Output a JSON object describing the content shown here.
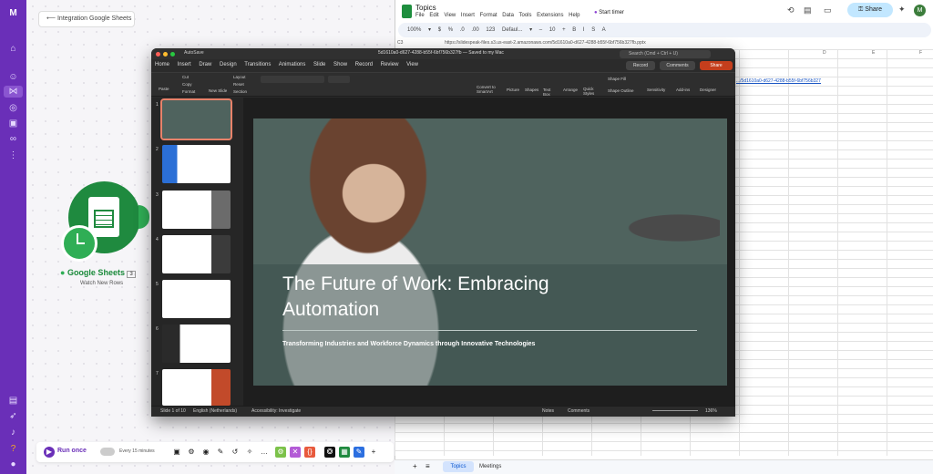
{
  "make": {
    "breadcrumb": "Integration Google Sheets",
    "module_name": "Google Sheets",
    "module_badge": "3",
    "module_sub": "Watch New Rows",
    "run_once": "Run once",
    "schedule": "Every 15 minutes"
  },
  "sheets": {
    "title": "Topics",
    "menu": "File Edit View Insert Format Data Tools Extensions Help",
    "timer": "Start timer",
    "share": "Share",
    "avatar": "M",
    "toolbar": "100% ▾   $   %   .0   .00   123   Defaul... ▾   –  10  +   B   I   S   A",
    "namebox": "C3",
    "formula": "https://slidespeak-files.s3.us-east-2.amazonaws.com/5d1610a0-d627-4288-b55f-6bf756b327fb.pptx",
    "cell_link": ".../5d1610a0-d627-4288-b55f-6bf756b327fb.pptx",
    "col_d": "D",
    "col_e": "E",
    "col_f": "F",
    "tab_topics": "Topics",
    "tab_meetings": "Meetings"
  },
  "ppt": {
    "autosave": "AutoSave",
    "file": "5d1610a0-d627-4288-b55f-6bf756b327fb — Saved to my Mac",
    "search": "Search (Cmd + Ctrl + U)",
    "tabs": "Home Insert Draw Design Transitions Animations Slide Show Record Review View",
    "record": "Record",
    "comments": "Comments",
    "share": "Share",
    "ribbon": {
      "paste": "Paste",
      "cut": "Cut",
      "copy": "Copy",
      "format": "Format",
      "new_slide": "New Slide",
      "layout": "Layout",
      "reset": "Reset",
      "section": "Section",
      "convert": "Convert to SmartArt",
      "picture": "Picture",
      "shapes": "Shapes",
      "textbox": "Text Box",
      "arrange": "Arrange",
      "quick": "Quick Styles",
      "fill": "Shape Fill",
      "outline": "Shape Outline",
      "sensitivity": "Sensitivity",
      "addins": "Add-ins",
      "designer": "Designer"
    },
    "slide_title": "The Future of Work: Embracing Automation",
    "slide_sub": "Transforming Industries and Workforce Dynamics through Innovative Technologies",
    "status_slide": "Slide 1 of 10",
    "status_lang": "English (Netherlands)",
    "status_access": "Accessibility: Investigate",
    "status_notes": "Notes",
    "status_comments": "Comments",
    "zoom": "136%",
    "thumbs": [
      "1",
      "2",
      "3",
      "4",
      "5",
      "6",
      "7"
    ]
  }
}
